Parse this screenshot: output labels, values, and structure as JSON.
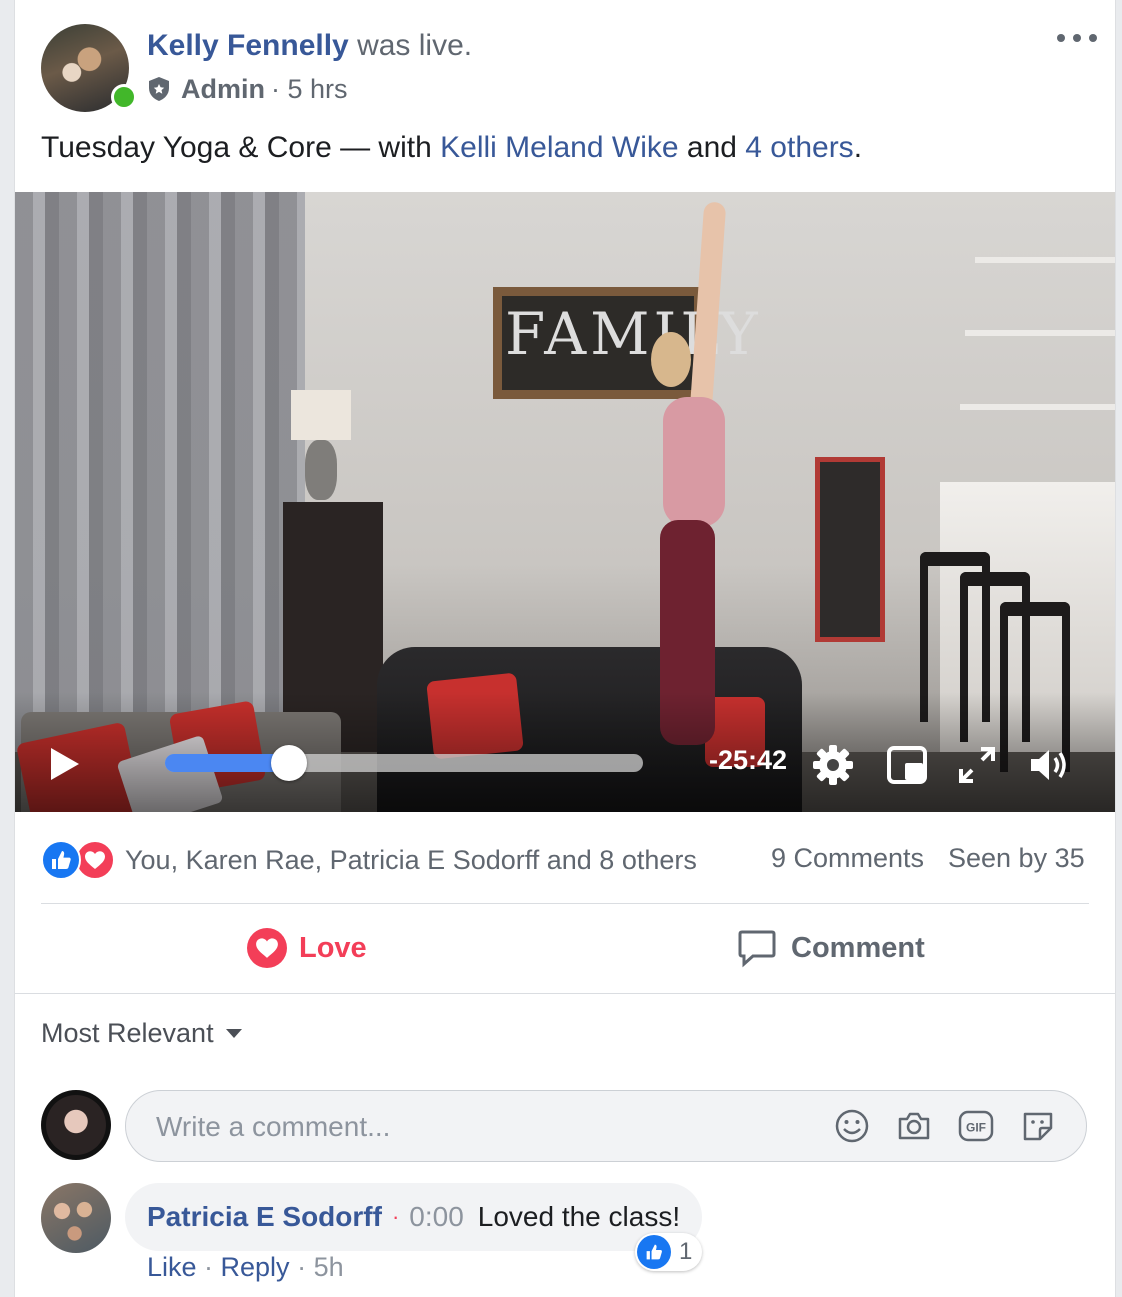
{
  "post": {
    "author": "Kelly Fennelly",
    "status_text": " was live.",
    "role": "Admin",
    "time_sep": "·",
    "time": "5 hrs",
    "text_main": "Tuesday Yoga & Core — with ",
    "tag_person": "Kelli Meland Wike",
    "text_and": " and ",
    "tag_others": "4 others",
    "text_end": "."
  },
  "video": {
    "time_remaining": "-25:42",
    "progress_fraction": 0.26,
    "sign_text": "FAMILY"
  },
  "reactions": {
    "names": "You, Karen Rae, Patricia E Sodorff and 8 others",
    "comments": "9 Comments",
    "seen": "Seen by 35"
  },
  "actions": {
    "love": "Love",
    "comment": "Comment"
  },
  "comments": {
    "sort_label": "Most Relevant",
    "input_placeholder": "Write a comment...",
    "items": [
      {
        "author": "Patricia E Sodorff",
        "separator": "·",
        "timestamp": "0:00",
        "text": "Loved the class!",
        "like_count": "1",
        "like": "Like",
        "reply": "Reply",
        "sep": " · ",
        "age": "5h"
      }
    ]
  },
  "colors": {
    "link": "#385898",
    "love": "#f33e58",
    "like": "#1877f2",
    "progress": "#4b87f2"
  }
}
